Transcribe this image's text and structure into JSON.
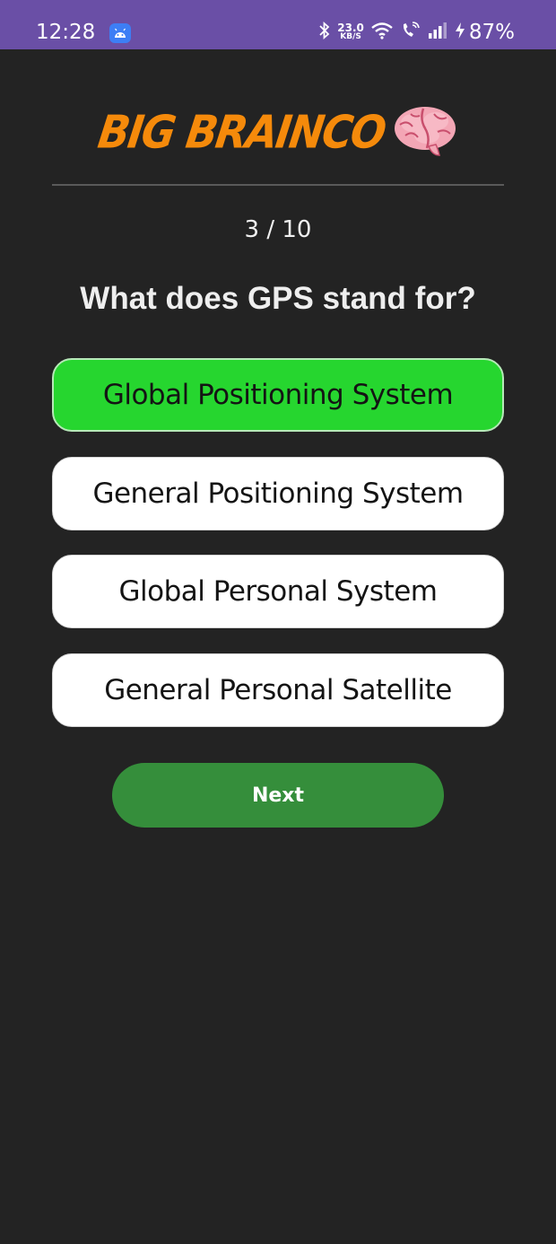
{
  "status_bar": {
    "time": "12:28",
    "network_speed_value": "23.0",
    "network_speed_unit": "KB/S",
    "battery": "87%"
  },
  "header": {
    "logo_text": "BIG BRAINCO",
    "logo_icon": "brain-icon",
    "logo_color": "#f58a0b"
  },
  "quiz": {
    "progress": "3 / 10",
    "question": "What does GPS stand for?",
    "options": [
      {
        "label": "Global Positioning System",
        "selected": true
      },
      {
        "label": "General Positioning System",
        "selected": false
      },
      {
        "label": "Global Personal System",
        "selected": false
      },
      {
        "label": "General Personal Satellite",
        "selected": false
      }
    ],
    "next_label": "Next"
  },
  "colors": {
    "background": "#232323",
    "status_bar": "#6a4fa6",
    "selected_option": "#26d62f",
    "next_button": "#358e3b"
  }
}
